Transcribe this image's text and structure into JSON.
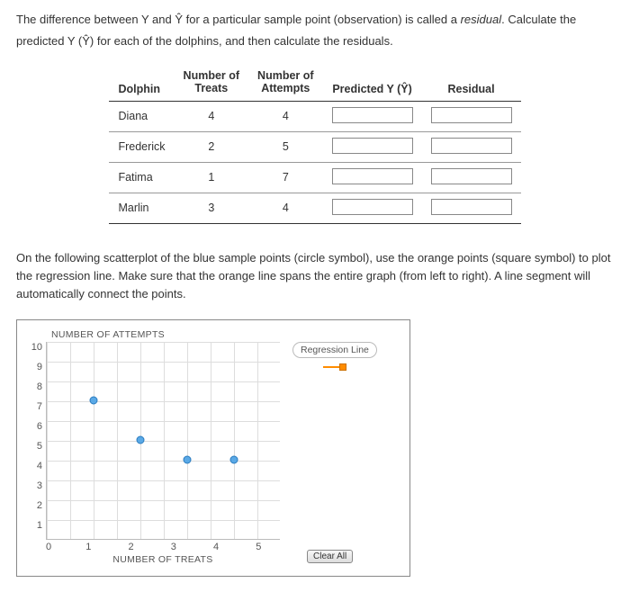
{
  "intro": {
    "line1_a": "The difference between Y and ",
    "line1_b": " for a particular sample point (observation) is called a ",
    "line1_c": "residual",
    "line1_d": ". Calculate the",
    "line2_a": "predicted Y (",
    "line2_b": ") for each of the dolphins, and then calculate the residuals.",
    "yhat": "Ŷ"
  },
  "table": {
    "headers": {
      "dolphin": "Dolphin",
      "treats_l1": "Number of",
      "treats_l2": "Treats",
      "attempts_l1": "Number of",
      "attempts_l2": "Attempts",
      "pred": "Predicted Y (Ŷ)",
      "resid": "Residual"
    },
    "rows": [
      {
        "name": "Diana",
        "treats": "4",
        "attempts": "4"
      },
      {
        "name": "Frederick",
        "treats": "2",
        "attempts": "5"
      },
      {
        "name": "Fatima",
        "treats": "1",
        "attempts": "7"
      },
      {
        "name": "Marlin",
        "treats": "3",
        "attempts": "4"
      }
    ]
  },
  "para2": "On the following scatterplot of the blue sample points (circle symbol), use the orange points (square symbol) to plot the regression line. Make sure that the orange line spans the entire graph (from left to right). A line segment will automatically connect the points.",
  "chart": {
    "ylabel": "NUMBER OF ATTEMPTS",
    "xlabel": "NUMBER OF TREATS",
    "legend": "Regression Line",
    "clear": "Clear All",
    "yticks": [
      "10",
      "9",
      "8",
      "7",
      "6",
      "5",
      "4",
      "3",
      "2",
      "1",
      ""
    ],
    "xticks": [
      "0",
      "1",
      "2",
      "3",
      "4",
      "5"
    ]
  },
  "chart_data": {
    "type": "scatter",
    "title": "",
    "xlabel": "NUMBER OF TREATS",
    "ylabel": "NUMBER OF ATTEMPTS",
    "xlim": [
      0,
      5
    ],
    "ylim": [
      0,
      10
    ],
    "series": [
      {
        "name": "Sample Points",
        "symbol": "circle",
        "color": "#5aa9e6",
        "points": [
          {
            "x": 1,
            "y": 7
          },
          {
            "x": 2,
            "y": 5
          },
          {
            "x": 3,
            "y": 4
          },
          {
            "x": 4,
            "y": 4
          }
        ]
      },
      {
        "name": "Regression Line",
        "symbol": "square",
        "color": "#ff8c00",
        "points": []
      }
    ]
  }
}
